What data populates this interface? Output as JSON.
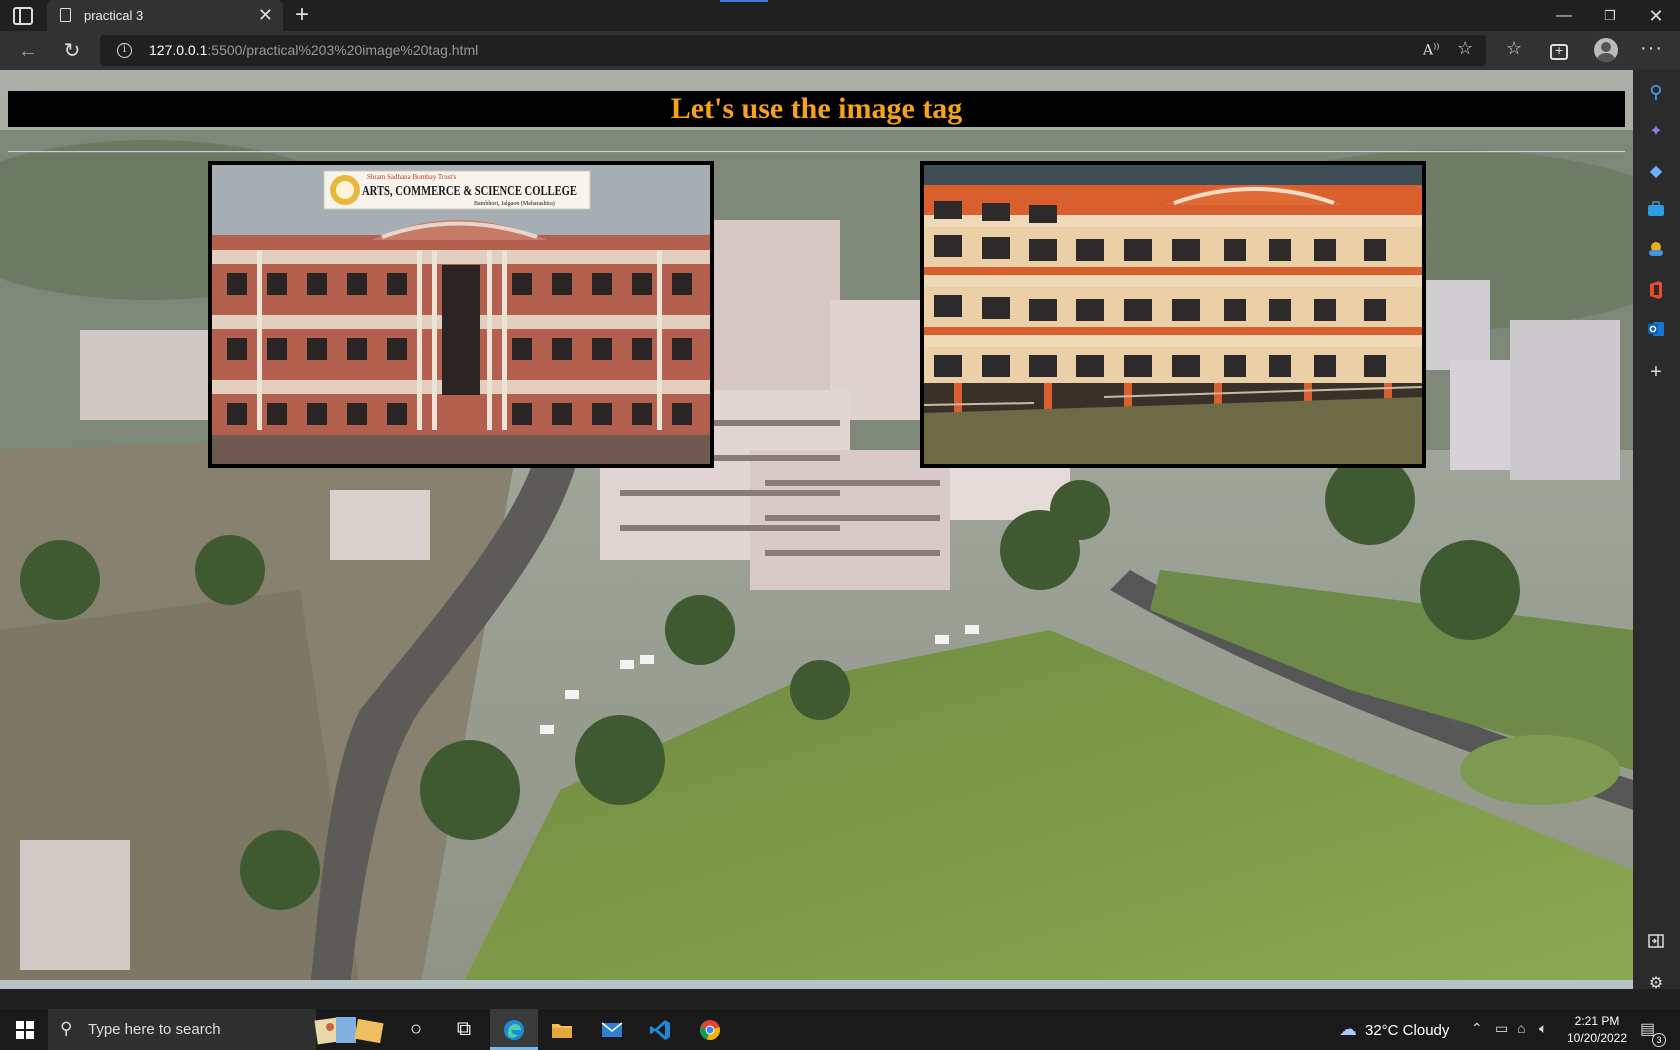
{
  "browser": {
    "tab_title": "practical 3",
    "tab_close": "✕",
    "new_tab": "+",
    "url_host": "127.0.0.1",
    "url_path": ":5500/practical%203%20image%20tag.html",
    "window_minimize": "—",
    "window_maximize": "❐",
    "window_close": "✕",
    "more_menu": "···",
    "icons": [
      "tab-actions-icon",
      "page-icon",
      "back-icon",
      "reload-icon",
      "info-icon",
      "read-aloud-icon",
      "add-favorite-icon",
      "favorites-icon",
      "collections-icon",
      "profile-icon",
      "more-icon"
    ]
  },
  "page": {
    "heading": "Let's use the image tag",
    "heading_color": "#f7a21b",
    "images": [
      {
        "sign_line1": "Shram Sadhana Bombay Trust's",
        "sign_line2": "ARTS, COMMERCE & SCIENCE COLLEGE",
        "sign_line3": "Bambhori, Jalgaon (Maharashtra)"
      },
      {
        "description": "orange college building facade"
      }
    ]
  },
  "sidebar": {
    "icons": [
      "search-icon",
      "discover-icon",
      "shopping-icon",
      "tools-icon",
      "games-icon",
      "office-icon",
      "outlook-icon",
      "add-icon",
      "hide-sidebar-icon",
      "settings-icon"
    ]
  },
  "taskbar": {
    "search_placeholder": "Type here to search",
    "weather": "32°C  Cloudy",
    "time": "2:21 PM",
    "date": "10/20/2022",
    "notification_count": "3",
    "apps": [
      "cortana-icon",
      "task-view-icon",
      "edge-icon",
      "file-explorer-icon",
      "mail-icon",
      "vscode-icon",
      "chrome-icon"
    ]
  }
}
